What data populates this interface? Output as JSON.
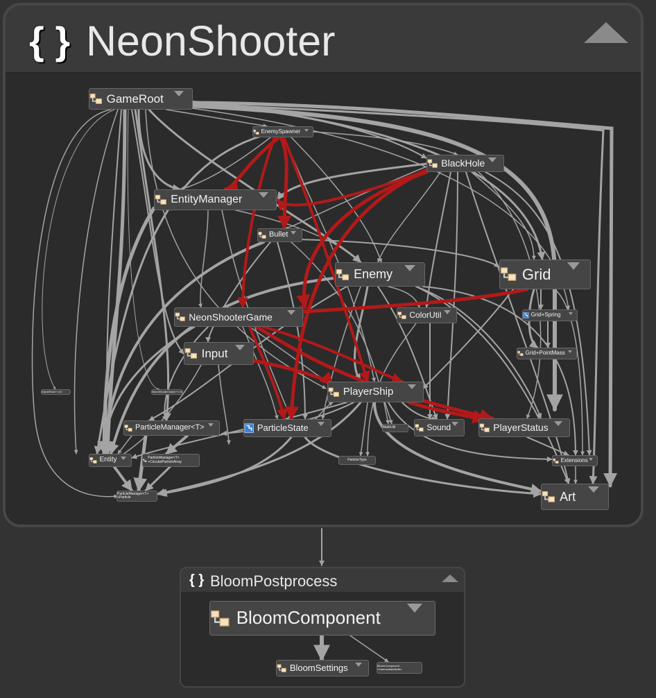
{
  "namespaces": {
    "main": {
      "braces": "{ }",
      "title": "NeonShooter"
    },
    "bloom": {
      "braces": "{ }",
      "title": "BloomPostprocess"
    }
  },
  "nodes": {
    "gameroot": "GameRoot",
    "enemyspawner": "EnemySpawner",
    "blackhole": "BlackHole",
    "entitymanager": "EntityManager",
    "bullet": "Bullet",
    "enemy": "Enemy",
    "grid": "Grid",
    "neonshootergame": "NeonShooterGame",
    "colorutil": "ColorUtil",
    "gridspring": "Grid+Spring",
    "input": "Input",
    "gridpointmass": "Grid+PointMass",
    "playership": "PlayerShip",
    "particlemanager": "ParticleManager<T>",
    "particlestate": "ParticleState",
    "mathutil": "MathUtil",
    "sound": "Sound",
    "playerstatus": "PlayerStatus",
    "entity": "Entity",
    "particlemanager_circular": "ParticleManager<T>\n+CircularParticleArray",
    "particletype": "ParticleType",
    "extensions": "Extensions",
    "particlemanager_particle": "ParticleManager<T>\n+Particle",
    "art": "Art",
    "gameroot_d": "GameRoot+<>D",
    "neonshooter_d": "NeonShooterGame+<>D",
    "bloomcomponent": "BloomComponent",
    "bloomsettings": "BloomSettings",
    "bloom_intermediate": "BloomComponent\n+IntermediateBuffer"
  },
  "colors": {
    "edge_gray": "#a4a4a4",
    "edge_red": "#b31919",
    "node_fill": "#454545",
    "group_fill": "#2b2b2b",
    "page_bg": "#333333"
  },
  "icons": {
    "class": "class-icon",
    "struct": "struct-icon"
  }
}
